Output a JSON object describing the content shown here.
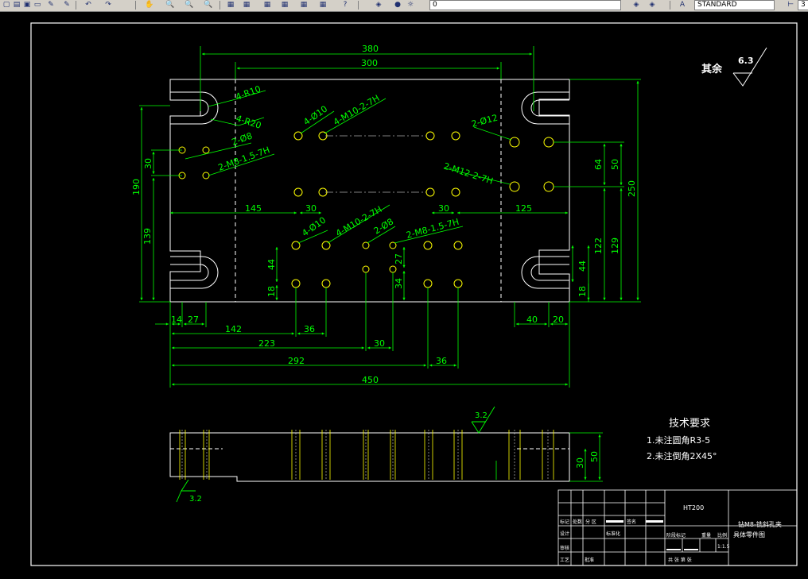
{
  "toolbar": {
    "layer_value": "0",
    "text_style": "STANDARD",
    "dimstyle_value": "3"
  },
  "drawing": {
    "dims": {
      "d380": "380",
      "d300": "300",
      "d4r10": "4-R10",
      "d4r20": "4-R20",
      "d2phi8": "2-Ø8",
      "d4phi10a": "4-Ø10",
      "d4m10a": "4-M10-2-7H",
      "d2m8a": "2-M8-1.5-7H",
      "d2phi12": "2-Ø12",
      "d2m12": "2-M12-2-7H",
      "d30a": "30",
      "d190": "190",
      "d139": "139",
      "d145": "145",
      "d30b": "30",
      "d30c": "30",
      "d125": "125",
      "d4phi10b": "4-Ø10",
      "d4m10b": "4-M10-2-7H",
      "d2phi8b": "2-Ø8",
      "d2m8b": "2-M8-1.5-7H",
      "d44a": "44",
      "d18a": "18",
      "d27a": "27",
      "d34": "34",
      "d64": "64",
      "d50a": "50",
      "d250": "250",
      "d122": "122",
      "d129": "129",
      "d44b": "44",
      "d18b": "18",
      "d14": "14",
      "d27b": "27",
      "d142": "142",
      "d36a": "36",
      "d223": "223",
      "d30d": "30",
      "d292": "292",
      "d36b": "36",
      "d450": "450",
      "d40": "40",
      "d20": "20",
      "d50b": "50",
      "d30e": "30"
    },
    "rough_other_label": "其余",
    "rough_other_value": "6.3",
    "rough_top": "3.2",
    "rough_bottom": "3.2",
    "tech_req_title": "技术要求",
    "tech_req_1": "1.未注圆角R3-5",
    "tech_req_2": "2.未注倒角2X45°",
    "title_block": {
      "material": "HT200",
      "drawing_title_1": "钻M8-铣斜孔夹",
      "drawing_title_2": "具体零件图",
      "scale": "1:1.5",
      "cells": [
        "标记",
        "处数",
        "分 区",
        "签名",
        "设计",
        "标准化",
        "阶段标记",
        "重量",
        "比例",
        "审核",
        "工艺",
        "批准",
        "共 张 第 张"
      ]
    }
  },
  "colors": {
    "background": "#000000",
    "geometry": "#ffffff",
    "dimension": "#00ff00",
    "hole": "#ffff00",
    "border": "#ffffff"
  }
}
